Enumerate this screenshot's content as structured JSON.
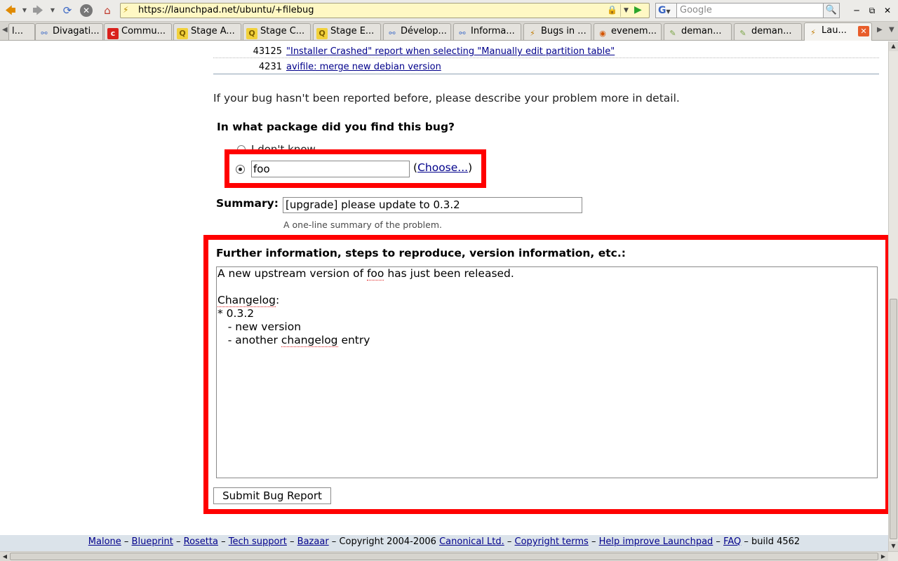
{
  "browser": {
    "url": "https://launchpad.net/ubuntu/+filebug",
    "search_placeholder": "Google",
    "search_engine_letter": "G",
    "tabs": [
      {
        "label": "l...",
        "favicon": "generic"
      },
      {
        "label": "Divagati...",
        "favicon": "divagations-icon"
      },
      {
        "label": "Commu...",
        "favicon": "c-icon"
      },
      {
        "label": "Stage A...",
        "favicon": "q-icon"
      },
      {
        "label": "Stage C...",
        "favicon": "q-icon"
      },
      {
        "label": "Stage E...",
        "favicon": "q-icon"
      },
      {
        "label": "Dévelop...",
        "favicon": "divagations-icon"
      },
      {
        "label": "Informa...",
        "favicon": "divagations-icon"
      },
      {
        "label": "Bugs in ...",
        "favicon": "bug-icon"
      },
      {
        "label": "evenem...",
        "favicon": "ubuntu-icon"
      },
      {
        "label": "deman...",
        "favicon": "pen-icon"
      },
      {
        "label": "deman...",
        "favicon": "pen-icon"
      },
      {
        "label": "Lau...",
        "favicon": "launchpad-icon",
        "active": true
      }
    ]
  },
  "results": [
    {
      "num": "43125",
      "title": "\"Installer Crashed\" report when selecting \"Manually edit partition table\""
    },
    {
      "num": "4231",
      "title": "avifile: merge new debian version"
    }
  ],
  "form": {
    "intro": "If your bug hasn't been reported before, please describe your problem more in detail.",
    "package_question": "In what package did you find this bug?",
    "dont_know_label": "I don't know",
    "package_value": "foo",
    "choose_open": "(",
    "choose_link": "Choose...",
    "choose_close": ")",
    "summary_label": "Summary:",
    "summary_value": "[upgrade] please update to 0.3.2",
    "summary_hint": "A one-line summary of the problem.",
    "further_label": "Further information, steps to reproduce, version information, etc.:",
    "further_lines": {
      "l1a": "A new upstream version of ",
      "l1b": "foo",
      "l1c": " has just been released.",
      "l3a": "Changelog",
      "l3b": ":",
      "l4": "* 0.3.2",
      "l5": "   - new version",
      "l6a": "   - another ",
      "l6b": "changelog",
      "l6c": " entry"
    },
    "submit_label": "Submit Bug Report"
  },
  "footer": {
    "malone": "Malone",
    "blueprint": "Blueprint",
    "rosetta": "Rosetta",
    "tech_support": "Tech support",
    "bazaar": "Bazaar",
    "copyright_text": "Copyright 2004-2006",
    "canonical": "Canonical Ltd.",
    "copyright_terms": "Copyright terms",
    "help_improve": "Help improve Launchpad",
    "faq": "FAQ",
    "build": "build 4562",
    "sep": " – "
  },
  "colors": {
    "highlight": "#ff0000",
    "link": "#00008b",
    "urlbar_bg": "#fff8c4",
    "footer_bg": "#dbe3ea"
  }
}
